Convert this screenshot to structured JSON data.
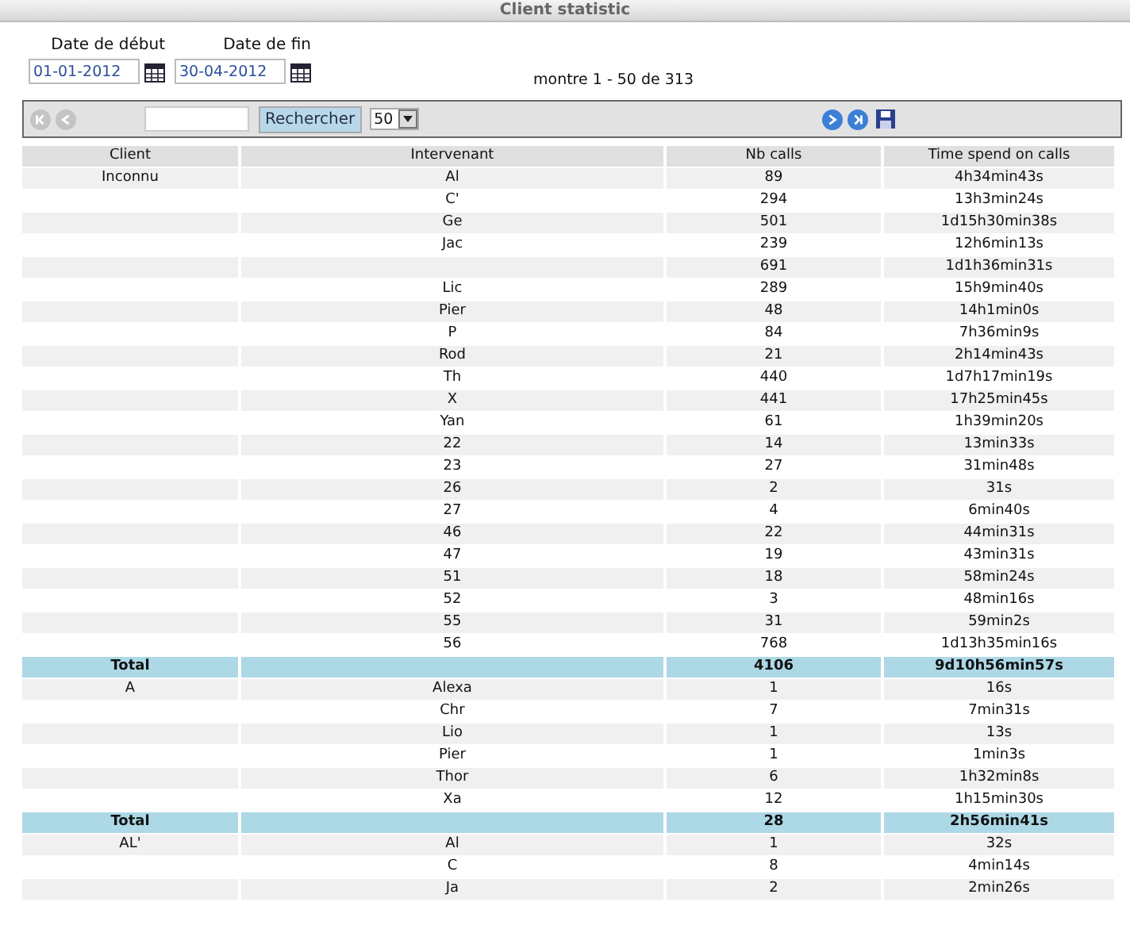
{
  "window": {
    "title": "Client statistic"
  },
  "filters": {
    "start": {
      "label": "Date de début",
      "value": "01-01-2012"
    },
    "end": {
      "label": "Date de fin",
      "value": "30-04-2012"
    }
  },
  "pager_info": "montre 1 - 50 de 313",
  "toolbar": {
    "nav_left": [
      {
        "kind": "first",
        "disabled": true
      },
      {
        "kind": "prev",
        "disabled": true
      }
    ],
    "search_button": "Rechercher",
    "page_size": "50",
    "nav_right": [
      {
        "kind": "next",
        "disabled": false
      },
      {
        "kind": "last",
        "disabled": false
      }
    ]
  },
  "table": {
    "columns": [
      "Client",
      "Intervenant",
      "Nb calls",
      "Time spend on calls"
    ],
    "rows": [
      {
        "kind": "data",
        "client": "Inconnu",
        "intervenant": "Al",
        "calls": "89",
        "time": "4h34min43s"
      },
      {
        "kind": "data",
        "intervenant": "C'",
        "calls": "294",
        "time": "13h3min24s"
      },
      {
        "kind": "data",
        "intervenant": "Ge",
        "calls": "501",
        "time": "1d15h30min38s"
      },
      {
        "kind": "data",
        "intervenant": "Jac",
        "calls": "239",
        "time": "12h6min13s"
      },
      {
        "kind": "data",
        "calls": "691",
        "time": "1d1h36min31s"
      },
      {
        "kind": "data",
        "intervenant": "Lic",
        "calls": "289",
        "time": "15h9min40s"
      },
      {
        "kind": "data",
        "intervenant": "Pier",
        "calls": "48",
        "time": "14h1min0s"
      },
      {
        "kind": "data",
        "intervenant": "P",
        "calls": "84",
        "time": "7h36min9s"
      },
      {
        "kind": "data",
        "intervenant": "Rod",
        "calls": "21",
        "time": "2h14min43s"
      },
      {
        "kind": "data",
        "intervenant": "Th",
        "calls": "440",
        "time": "1d7h17min19s"
      },
      {
        "kind": "data",
        "intervenant": "X",
        "calls": "441",
        "time": "17h25min45s"
      },
      {
        "kind": "data",
        "intervenant": "Yan",
        "calls": "61",
        "time": "1h39min20s"
      },
      {
        "kind": "data",
        "intervenant": "22",
        "calls": "14",
        "time": "13min33s"
      },
      {
        "kind": "data",
        "intervenant": "23",
        "calls": "27",
        "time": "31min48s"
      },
      {
        "kind": "data",
        "intervenant": "26",
        "calls": "2",
        "time": "31s"
      },
      {
        "kind": "data",
        "intervenant": "27",
        "calls": "4",
        "time": "6min40s"
      },
      {
        "kind": "data",
        "intervenant": "46",
        "calls": "22",
        "time": "44min31s"
      },
      {
        "kind": "data",
        "intervenant": "47",
        "calls": "19",
        "time": "43min31s"
      },
      {
        "kind": "data",
        "intervenant": "51",
        "calls": "18",
        "time": "58min24s"
      },
      {
        "kind": "data",
        "intervenant": "52",
        "calls": "3",
        "time": "48min16s"
      },
      {
        "kind": "data",
        "intervenant": "55",
        "calls": "31",
        "time": "59min2s"
      },
      {
        "kind": "data",
        "intervenant": "56",
        "calls": "768",
        "time": "1d13h35min16s"
      },
      {
        "kind": "total",
        "client": "Total",
        "calls": "4106",
        "time": "9d10h56min57s"
      },
      {
        "kind": "data",
        "client": "A",
        "intervenant": "Alexa",
        "calls": "1",
        "time": "16s"
      },
      {
        "kind": "data",
        "intervenant": "Chr",
        "calls": "7",
        "time": "7min31s"
      },
      {
        "kind": "data",
        "intervenant": "Lio",
        "calls": "1",
        "time": "13s"
      },
      {
        "kind": "data",
        "intervenant": "Pier",
        "calls": "1",
        "time": "1min3s"
      },
      {
        "kind": "data",
        "intervenant": "Thor",
        "calls": "6",
        "time": "1h32min8s"
      },
      {
        "kind": "data",
        "intervenant": "Xa",
        "calls": "12",
        "time": "1h15min30s"
      },
      {
        "kind": "total",
        "client": "Total",
        "calls": "28",
        "time": "2h56min41s"
      },
      {
        "kind": "data",
        "client": "AL'",
        "intervenant": "Al",
        "calls": "1",
        "time": "32s"
      },
      {
        "kind": "data",
        "intervenant": "C",
        "calls": "8",
        "time": "4min14s"
      },
      {
        "kind": "data",
        "intervenant": "Ja",
        "calls": "2",
        "time": "2min26s"
      }
    ]
  }
}
